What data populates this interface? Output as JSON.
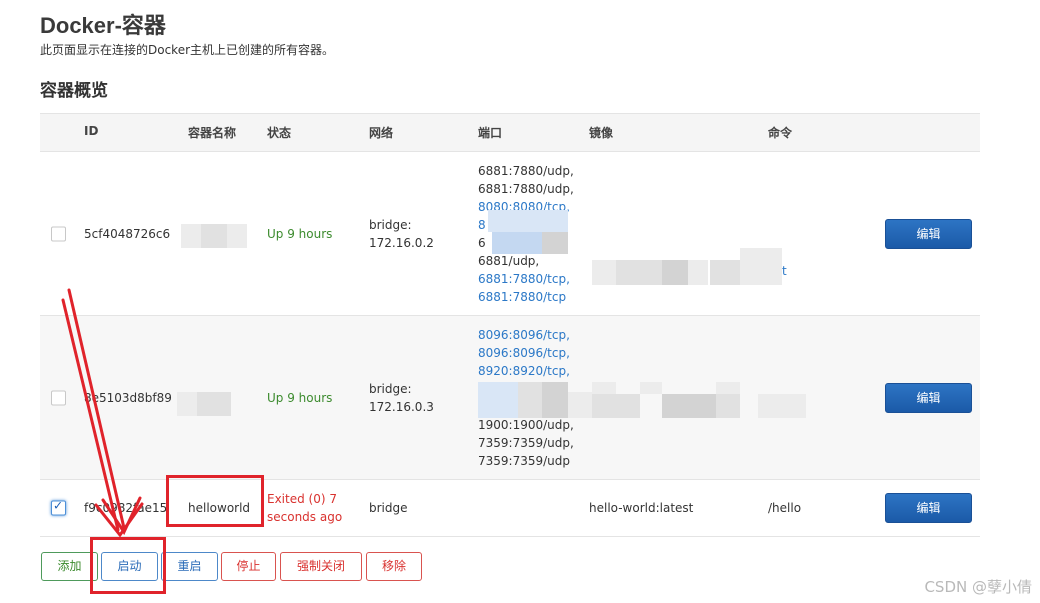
{
  "header": {
    "title": "Docker-容器",
    "description": "此页面显示在连接的Docker主机上已创建的所有容器。"
  },
  "section": {
    "title": "容器概览"
  },
  "table": {
    "columns": [
      "ID",
      "容器名称",
      "状态",
      "网络",
      "端口",
      "镜像",
      "命令"
    ],
    "rows": [
      {
        "checked": false,
        "id": "5cf4048726c6",
        "name": "",
        "status": "Up 9 hours",
        "network": [
          "bridge:",
          "172.16.0.2"
        ],
        "ports": [
          {
            "text": "6881:7880/udp,",
            "link": false
          },
          {
            "text": "6881:7880/udp,",
            "link": false
          },
          {
            "text": "8080:8080/tcp,",
            "link": true
          },
          {
            "text": "8",
            "link": true
          },
          {
            "text": "6",
            "link": false
          },
          {
            "text": "6881/udp,",
            "link": false
          },
          {
            "text": "6881:7880/tcp,",
            "link": true
          },
          {
            "text": "6881:7880/tcp",
            "link": true
          }
        ],
        "image": "",
        "command": "t",
        "edit_label": "编辑"
      },
      {
        "checked": false,
        "id": "8e5103d8bf89",
        "name": "",
        "status": "Up 9 hours",
        "network": [
          "bridge:",
          "172.16.0.3"
        ],
        "ports": [
          {
            "text": "8096:8096/tcp,",
            "link": true
          },
          {
            "text": "8096:8096/tcp,",
            "link": true
          },
          {
            "text": "8920:8920/tcp,",
            "link": true
          },
          {
            "text": "",
            "link": false
          },
          {
            "text": "",
            "link": false
          },
          {
            "text": "1900:1900/udp,",
            "link": false
          },
          {
            "text": "7359:7359/udp,",
            "link": false
          },
          {
            "text": "7359:7359/udp",
            "link": false
          }
        ],
        "image": "",
        "command": "",
        "edit_label": "编辑"
      },
      {
        "checked": true,
        "id": "f9c0982fae15",
        "name": "helloworld",
        "status": [
          "Exited (0) 7",
          "seconds ago"
        ],
        "network": [
          "bridge"
        ],
        "ports": [],
        "image": "hello-world:latest",
        "command": "/hello",
        "edit_label": "编辑"
      }
    ]
  },
  "actions": {
    "add": "添加",
    "start": "启动",
    "restart": "重启",
    "stop": "停止",
    "kill": "强制关闭",
    "remove": "移除"
  },
  "watermark": "CSDN @孽小倩",
  "colors": {
    "annotation": "#e0232b",
    "status_up": "#3c8b2e",
    "status_exited": "#d9322f",
    "port_link": "#2b78c7",
    "edit_button": "#1f62b3"
  }
}
